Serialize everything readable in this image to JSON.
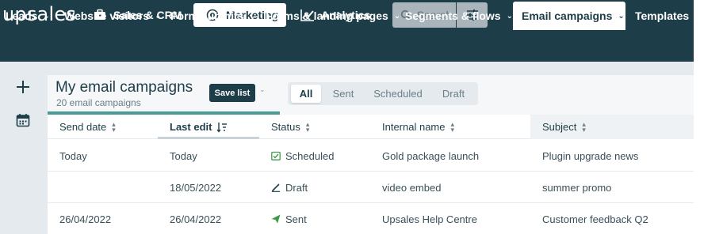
{
  "app": {
    "logo": "upsales"
  },
  "topnav": {
    "items": [
      {
        "label": "Sales & CRM",
        "icon": "briefcase-icon"
      },
      {
        "label": "Marketing",
        "icon": "target-icon",
        "active": true
      },
      {
        "label": "Analytics",
        "icon": "line-chart-icon"
      }
    ],
    "search_placeholder": "Search"
  },
  "subnav": {
    "items": [
      {
        "label": "Leads"
      },
      {
        "label": "Website visitors"
      },
      {
        "label": "Form submits"
      },
      {
        "label": "Forms & landing pages"
      },
      {
        "label": "Segments & flows"
      },
      {
        "label": "Email campaigns",
        "active": true
      },
      {
        "label": "Templates"
      }
    ]
  },
  "page": {
    "title": "My email campaigns",
    "subtitle": "20 email campaigns",
    "save_list_label": "Save list"
  },
  "tabs": [
    {
      "label": "All",
      "active": true
    },
    {
      "label": "Sent"
    },
    {
      "label": "Scheduled"
    },
    {
      "label": "Draft"
    }
  ],
  "table": {
    "columns": [
      {
        "label": "Send date"
      },
      {
        "label": "Last edit",
        "sorted": "desc"
      },
      {
        "label": "Status"
      },
      {
        "label": "Internal name"
      },
      {
        "label": "Subject"
      }
    ],
    "rows": [
      {
        "send_date": "Today",
        "last_edit": "Today",
        "status": "Scheduled",
        "status_icon": "calendar-check-icon",
        "internal_name": "Gold package launch",
        "subject": "Plugin upgrade news"
      },
      {
        "send_date": "",
        "last_edit": "18/05/2022",
        "status": "Draft",
        "status_icon": "pencil-icon",
        "internal_name": "video embed",
        "subject": "summer promo"
      },
      {
        "send_date": "26/04/2022",
        "last_edit": "26/04/2022",
        "status": "Sent",
        "status_icon": "paper-plane-icon",
        "internal_name": "Upsales Help Centre",
        "subject": "Customer feedback Q2"
      }
    ]
  },
  "colors": {
    "brand_dark": "#1d3d48",
    "accent_green": "#4a9a96",
    "status_green": "#3d9a4a"
  }
}
